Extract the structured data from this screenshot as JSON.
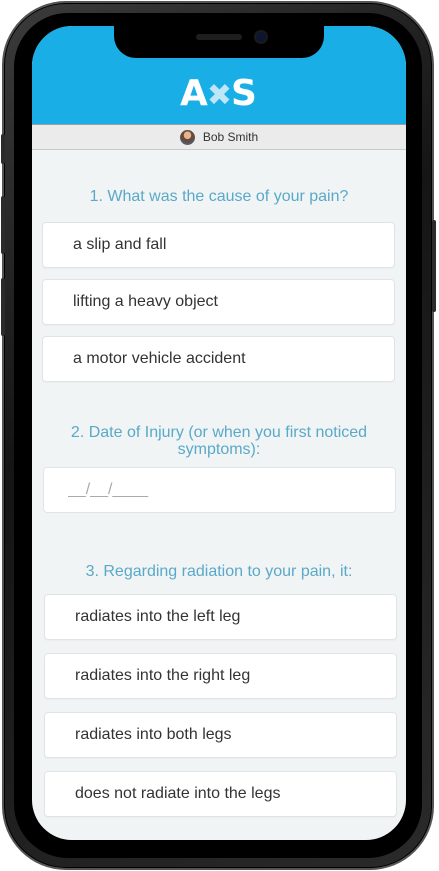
{
  "app": {
    "logo_left": "A",
    "logo_right": "S"
  },
  "user": {
    "name": "Bob Smith"
  },
  "questions": [
    {
      "title": "1. What was the cause of your pain?",
      "options": [
        "a slip and fall",
        "lifting a heavy object",
        "a motor vehicle accident"
      ]
    },
    {
      "title": "2. Date of Injury (or when you first noticed symptoms):",
      "placeholder": "__/__/____"
    },
    {
      "title": "3. Regarding radiation to your pain, it:",
      "options": [
        "radiates into the left leg",
        "radiates into the right leg",
        "radiates into both legs",
        "does not radiate into the legs"
      ]
    }
  ],
  "colors": {
    "header": "#19aee6",
    "question_text": "#5aa9c8",
    "background": "#f0f4f5"
  }
}
